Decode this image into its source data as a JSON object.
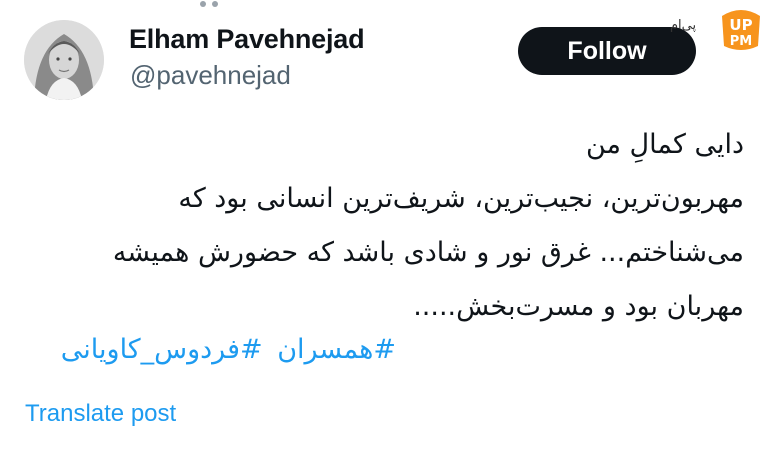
{
  "profile": {
    "display_name": "Elham Pavehnejad",
    "handle": "@pavehnejad",
    "follow_label": "Follow"
  },
  "watermark": {
    "text": "پی‌ام‌",
    "logo_letters": "PM"
  },
  "tweet": {
    "lines": [
      "دایی کمالِ من",
      "مهربون‌ترین، نجیب‌ترین، شریف‌ترین انسانی بود که",
      "می‌شناختم... غرق نور و شادی باشد که حضورش همیشه",
      "مهربان بود و مسرت‌بخش....."
    ],
    "hashtags": [
      "#همسران",
      "#فردوس_کاویانی"
    ]
  },
  "translate_label": "Translate post",
  "colors": {
    "link": "#1d9bf0",
    "follow_bg": "#0f1419",
    "handle": "#536471",
    "watermark_orange": "#f7941d"
  }
}
